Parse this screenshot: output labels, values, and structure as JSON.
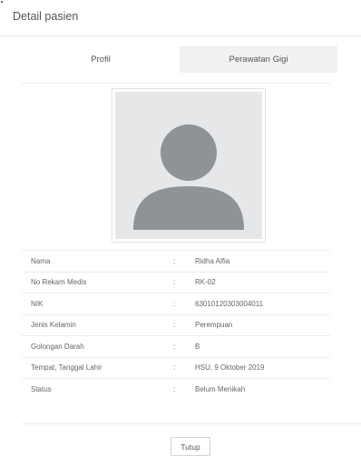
{
  "modal": {
    "title": "Detail pasien"
  },
  "tabs": [
    {
      "label": "Profil",
      "active": true
    },
    {
      "label": "Perawatan Gigi",
      "active": false
    }
  ],
  "photo": {
    "icon": "user-avatar-placeholder-icon",
    "bg_color": "#e6e7e9",
    "silhouette_color": "#8f9296"
  },
  "patient": {
    "rows": [
      {
        "label": "Nama",
        "separator": ":",
        "value": "Ridha Alfia"
      },
      {
        "label": "No Rekam Medis",
        "separator": ":",
        "value": "RK-02"
      },
      {
        "label": "NIK",
        "separator": ":",
        "value": "63010120303004011"
      },
      {
        "label": "Jenis Kelamin",
        "separator": ":",
        "value": "Perempuan"
      },
      {
        "label": "Golongan Darah",
        "separator": ":",
        "value": "B"
      },
      {
        "label": "Tempat, Tanggal Lahir",
        "separator": ":",
        "value": "HSU, 9 Oktober 2019"
      },
      {
        "label": "Status",
        "separator": ":",
        "value": "Belum Menikah"
      }
    ]
  },
  "footer": {
    "close_label": "Tutup"
  }
}
